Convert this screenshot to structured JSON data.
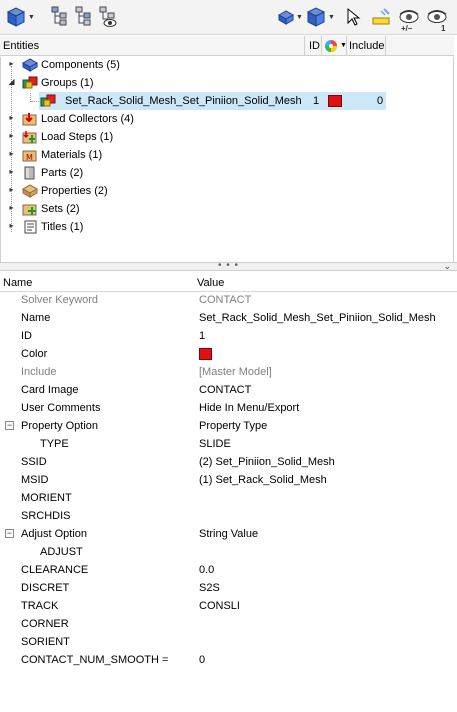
{
  "header": {
    "entities": "Entities",
    "id": "ID",
    "include": "Include"
  },
  "tree": [
    {
      "label": "Components (5)",
      "icon": "components-icon"
    },
    {
      "label": "Groups (1)",
      "icon": "groups-icon",
      "expanded": true
    },
    {
      "label": "Set_Rack_Solid_Mesh_Set_Piniion_Solid_Mesh",
      "icon": "group-item-icon",
      "id": "1",
      "include": "0",
      "selected": true
    },
    {
      "label": "Load Collectors (4)",
      "icon": "load-collectors-icon"
    },
    {
      "label": "Load Steps (1)",
      "icon": "load-steps-icon"
    },
    {
      "label": "Materials (1)",
      "icon": "materials-icon"
    },
    {
      "label": "Parts (2)",
      "icon": "parts-icon"
    },
    {
      "label": "Properties (2)",
      "icon": "properties-icon"
    },
    {
      "label": "Sets (2)",
      "icon": "sets-icon"
    },
    {
      "label": "Titles (1)",
      "icon": "titles-icon"
    }
  ],
  "props_header": {
    "name": "Name",
    "value": "Value"
  },
  "props": [
    {
      "name": "Solver Keyword",
      "value": "CONTACT",
      "gray": true
    },
    {
      "name": "Name",
      "value": "Set_Rack_Solid_Mesh_Set_Piniion_Solid_Mesh"
    },
    {
      "name": "ID",
      "value": "1"
    },
    {
      "name": "Color",
      "value": "",
      "swatch": true
    },
    {
      "name": "Include",
      "value": "[Master Model]",
      "gray": true
    },
    {
      "name": "Card Image",
      "value": "CONTACT"
    },
    {
      "name": "User Comments",
      "value": "Hide In Menu/Export"
    },
    {
      "name": "Property Option",
      "value": "Property Type",
      "group": true
    },
    {
      "name": "TYPE",
      "value": "SLIDE",
      "indent": true
    },
    {
      "name": "SSID",
      "value": "(2) Set_Piniion_Solid_Mesh"
    },
    {
      "name": "MSID",
      "value": "(1) Set_Rack_Solid_Mesh"
    },
    {
      "name": "MORIENT",
      "value": ""
    },
    {
      "name": "SRCHDIS",
      "value": ""
    },
    {
      "name": "Adjust Option",
      "value": "String Value",
      "group": true
    },
    {
      "name": "ADJUST",
      "value": "",
      "indent": true
    },
    {
      "name": "CLEARANCE",
      "value": "0.0"
    },
    {
      "name": "DISCRET",
      "value": "S2S"
    },
    {
      "name": "TRACK",
      "value": "CONSLI"
    },
    {
      "name": "CORNER",
      "value": ""
    },
    {
      "name": "SORIENT",
      "value": ""
    },
    {
      "name": "CONTACT_NUM_SMOOTH =",
      "value": "0"
    }
  ],
  "toolbar": {
    "eye_plusminus": "+/–",
    "eye_one": "1"
  },
  "colors": {
    "swatch": "#dd1111",
    "selection": "#cce8f8"
  }
}
